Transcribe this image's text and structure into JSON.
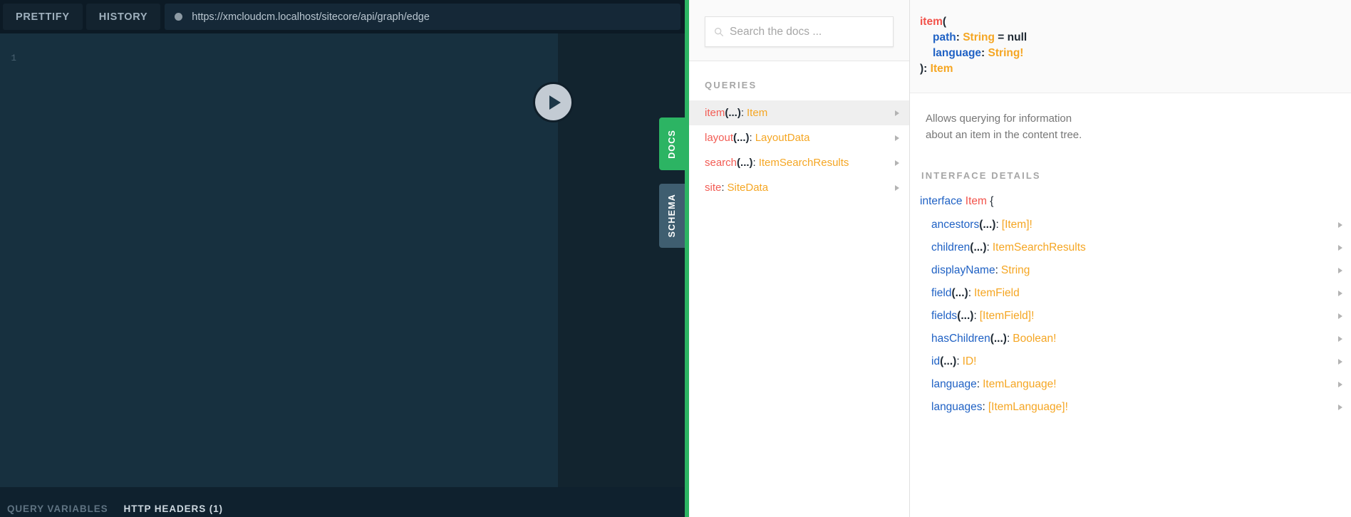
{
  "toolbar": {
    "prettify_label": "PRETTIFY",
    "history_label": "HISTORY",
    "url": "https://xmcloudcm.localhost/sitecore/api/graph/edge"
  },
  "editor": {
    "line_number": "1",
    "content": ""
  },
  "bottom_tabs": [
    {
      "label": "QUERY VARIABLES",
      "active": false
    },
    {
      "label": "HTTP HEADERS (1)",
      "active": true
    }
  ],
  "side_tabs": [
    {
      "label": "DOCS",
      "color": "#2cb463",
      "active": true
    },
    {
      "label": "SCHEMA",
      "color": "#3f5e70",
      "active": false
    }
  ],
  "docs": {
    "search_placeholder": "Search the docs ...",
    "search_value": "",
    "section_title": "QUERIES",
    "items": [
      {
        "name": "item",
        "args": "(...)",
        "colon": ":",
        "type": "Item",
        "active": true
      },
      {
        "name": "layout",
        "args": "(...)",
        "colon": ":",
        "type": "LayoutData",
        "active": false
      },
      {
        "name": "search",
        "args": "(...)",
        "colon": ":",
        "type": "ItemSearchResults",
        "active": false
      },
      {
        "name": "site",
        "args": "",
        "colon": ":",
        "type": "SiteData",
        "active": false
      }
    ]
  },
  "detail": {
    "signature": {
      "fn": "item",
      "open_paren": "(",
      "args": [
        {
          "name": "path",
          "colon": ":",
          "type": "String",
          "default": "= null"
        },
        {
          "name": "language",
          "colon": ":",
          "type": "String!",
          "default": ""
        }
      ],
      "close": "):",
      "return_type": "Item"
    },
    "description": "Allows querying for information about an item in the content tree.",
    "interface_title": "INTERFACE DETAILS",
    "interface_keyword": "interface",
    "interface_name": "Item",
    "interface_brace": "{",
    "fields": [
      {
        "name": "ancestors",
        "args": "(...)",
        "colon": ":",
        "type": "[Item]!"
      },
      {
        "name": "children",
        "args": "(...)",
        "colon": ":",
        "type": "ItemSearchResults"
      },
      {
        "name": "displayName",
        "args": "",
        "colon": ":",
        "type": "String"
      },
      {
        "name": "field",
        "args": "(...)",
        "colon": ":",
        "type": "ItemField"
      },
      {
        "name": "fields",
        "args": "(...)",
        "colon": ":",
        "type": "[ItemField]!"
      },
      {
        "name": "hasChildren",
        "args": "(...)",
        "colon": ":",
        "type": "Boolean!"
      },
      {
        "name": "id",
        "args": "(...)",
        "colon": ":",
        "type": "ID!"
      },
      {
        "name": "language",
        "args": "",
        "colon": ":",
        "type": "ItemLanguage!"
      },
      {
        "name": "languages",
        "args": "",
        "colon": ":",
        "type": "[ItemLanguage]!"
      }
    ]
  },
  "colors": {
    "accent_green": "#2cb463",
    "editor_bg": "#17303f",
    "chrome_bg": "#0f212e",
    "field_blue": "#1f61c4",
    "type_orange": "#f5a623",
    "name_red": "#f2524a"
  }
}
